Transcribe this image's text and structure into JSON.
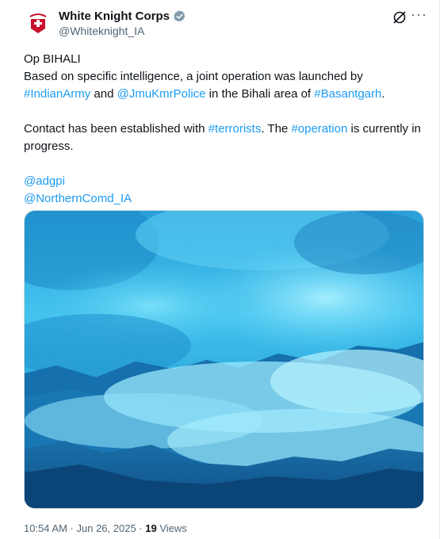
{
  "author": {
    "name": "White Knight Corps",
    "handle": "@Whiteknight_IA",
    "avatar_icon": "white-knight-corps-emblem"
  },
  "header_icons": {
    "grok": "grok-icon",
    "more": "···"
  },
  "tweet": {
    "line1": "Op BIHALI",
    "p1_text1": "Based on specific intelligence, a joint operation was launched by ",
    "p1_tag1": "#IndianArmy",
    "p1_text2": " and ",
    "p1_mention1": "@JmuKmrPolice",
    "p1_text3": " in the Bihali  area of ",
    "p1_tag2": "#Basantgarh",
    "p1_text4": ".",
    "p2_text1": "Contact has been established with ",
    "p2_tag1": "#terrorists",
    "p2_text2": ". The ",
    "p2_tag2": "#operation",
    "p2_text3": " is currently in progress.",
    "mention2": "@adgpi",
    "mention3": "@NorthernComd_IA"
  },
  "media": {
    "type": "photo"
  },
  "meta": {
    "time": "10:54 AM",
    "dot1": " · ",
    "date": "Jun 26, 2025",
    "dot2": " · ",
    "views_count": "19",
    "views_label": " Views"
  },
  "colors": {
    "link": "#1d9bf0",
    "verified": "#829aab",
    "text": "#0f1419",
    "muted": "#536471"
  }
}
